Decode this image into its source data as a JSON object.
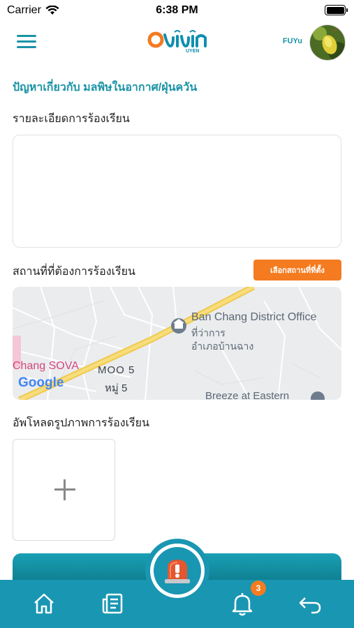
{
  "status_bar": {
    "carrier": "Carrier",
    "time": "6:38 PM"
  },
  "header": {
    "logo_text": "อยู่เย็น",
    "logo_subtext": "UYEN",
    "user_name": "FUYu"
  },
  "form": {
    "title": "ปัญหาเกี่ยวกับ มลพิษในอากาศ/ฝุ่นควัน",
    "details_label": "รายละเอียดการร้องเรียน",
    "details_value": "",
    "location_label": "สถานที่ที่ต้องการร้องเรียน",
    "location_button": "เลือกสถานที่ที่ตั้ง",
    "upload_label": "อัพโหลดรูปภาพการร้องเรียน"
  },
  "map": {
    "poi_name": "Ban Chang District Office",
    "poi_name_th_1": "ที่ว่าการ",
    "poi_name_th_2": "อำเภอบ้านฉาง",
    "area_label_1": "MOO 5",
    "area_label_2": "หมู่ 5",
    "place_left": "Chang SOVA",
    "place_bottom": "Breeze at Eastern",
    "attribution": "Google",
    "road_color": "#f5d76e"
  },
  "bottom_nav": {
    "items": [
      "home-icon",
      "news-icon",
      "sos-alarm-icon",
      "notification-bell-icon",
      "back-icon"
    ],
    "notification_count": "3"
  },
  "colors": {
    "primary": "#1996b2",
    "accent": "#f47b20",
    "title": "#1a93a6"
  }
}
